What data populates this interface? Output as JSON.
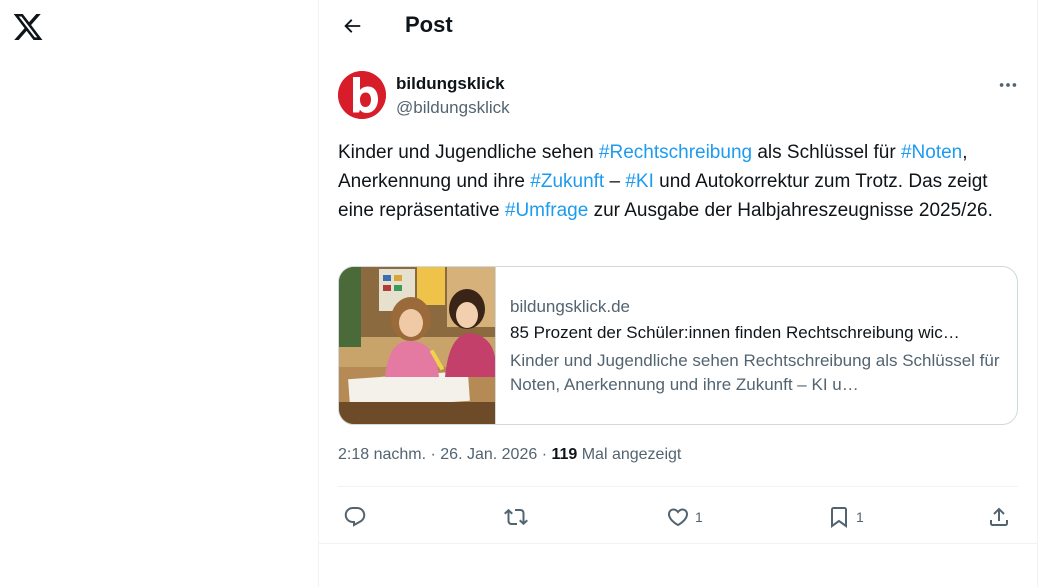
{
  "header": {
    "title": "Post"
  },
  "author": {
    "name": "bildungsklick",
    "handle": "@bildungsklick"
  },
  "tweet": {
    "t1": "Kinder und Jugendliche sehen ",
    "h1": "#Rechtschreibung",
    "t2": " als Schlüssel für ",
    "h2": "#Noten",
    "t3": ", Anerkennung und ihre ",
    "h3": "#Zukunft",
    "t4": " – ",
    "h4": "#KI",
    "t5": " und Autokorrektur zum Trotz. Das zeigt eine repräsentative ",
    "h5": "#Umfrage",
    "t6": " zur Ausgabe der Halbjahreszeugnisse 2025/26."
  },
  "card": {
    "domain": "bildungsklick.de",
    "title": "85 Prozent der Schüler:innen finden Rechtschreibung wic…",
    "description": "Kinder und Jugendliche sehen Rechtschreibung als Schlüssel für Noten, Anerkennung und ihre Zukunft – KI u…"
  },
  "meta": {
    "time": "2:18 nachm.",
    "sep1": " · ",
    "date": "26. Jan. 2026",
    "sep2": " · ",
    "views": "119",
    "views_label": " Mal angezeigt"
  },
  "actions": {
    "reply_icon": "reply-icon",
    "repost_icon": "repost-icon",
    "like_icon": "heart-icon",
    "like_count": "1",
    "bookmark_icon": "bookmark-icon",
    "bookmark_count": "1",
    "share_icon": "share-icon"
  },
  "colors": {
    "accent": "#1d9bf0",
    "text": "#0f1419",
    "secondary": "#536471",
    "border": "#cfd9de",
    "avatar_red": "#d71d2a"
  }
}
